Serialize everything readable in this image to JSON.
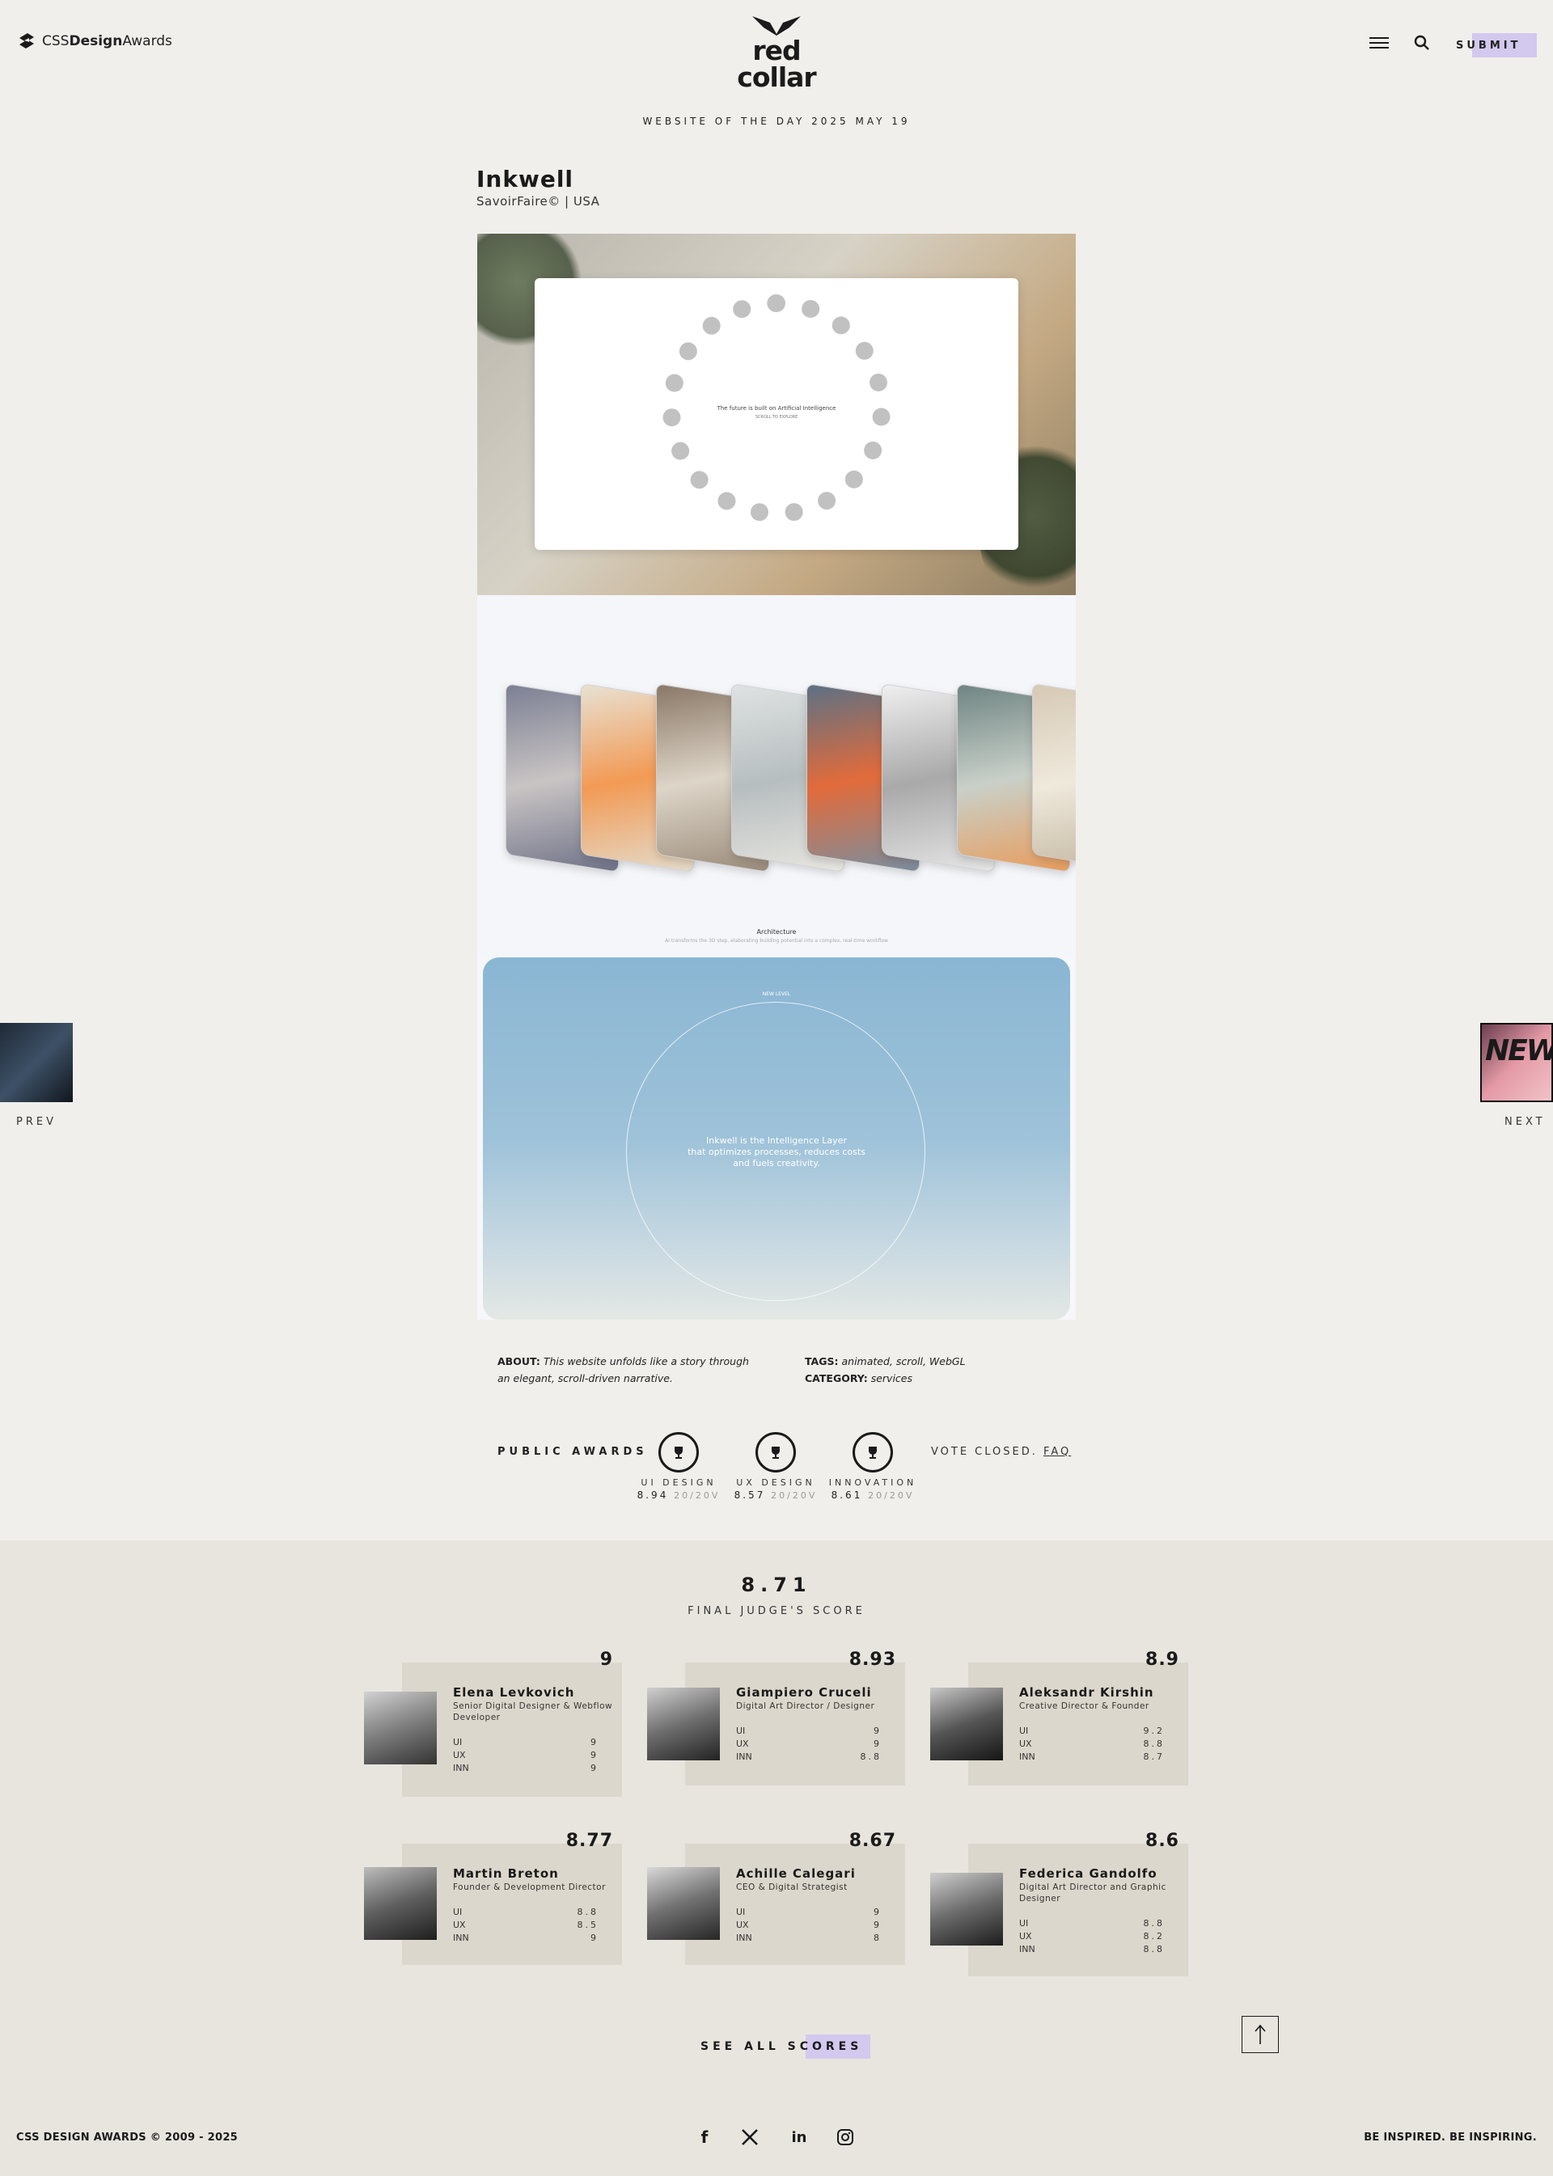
{
  "header": {
    "cssda_logo": {
      "pre": "CSS",
      "bold": "Design",
      "post": "Awards"
    },
    "brand_name": "red collar",
    "submit_label": "SUBMIT"
  },
  "wotd_label": "WEBSITE OF THE DAY 2025 MAY 19",
  "site": {
    "title": "Inkwell",
    "meta": "SavoirFaire©  |  USA"
  },
  "preview": {
    "ring_text": "The future is built on Artificial Intelligence",
    "ring_sub": "SCROLL TO EXPLORE",
    "panel_caption": "Architecture",
    "panel_caption_sub": "AI transforms the 3D step, elaborating building potential into a complex, real-time workflow",
    "blue_small": "NEW LEVEL",
    "blue_text_lines": [
      "Inkwell is the Intelligence Layer",
      "that optimizes processes, reduces costs",
      "and fuels creativity."
    ]
  },
  "nav": {
    "prev_label": "PREV",
    "next_label": "NEXT",
    "next_thumb_text": "NEW"
  },
  "about": {
    "about_label": "ABOUT:",
    "about_text": "This website unfolds like a story through an elegant, scroll-driven narrative.",
    "tags_label": "TAGS:",
    "tags_text": "animated, scroll, WebGL",
    "category_label": "CATEGORY:",
    "category_text": "services"
  },
  "public_awards": {
    "label": "PUBLIC AWARDS",
    "items": [
      {
        "label": "UI DESIGN",
        "score": "8.94",
        "votes": "20/20V"
      },
      {
        "label": "UX DESIGN",
        "score": "8.57",
        "votes": "20/20V"
      },
      {
        "label": "INNOVATION",
        "score": "8.61",
        "votes": "20/20V"
      }
    ],
    "vote_closed": "VOTE CLOSED.",
    "faq": "FAQ"
  },
  "judges": {
    "final_score": "8.71",
    "final_label": "FINAL JUDGE'S SCORE",
    "list": [
      {
        "name": "Elena Levkovich",
        "role": "Senior Digital Designer & Webflow Developer",
        "score": "9",
        "ui": "9",
        "ux": "9",
        "inn": "9"
      },
      {
        "name": "Giampiero Cruceli",
        "role": "Digital Art Director / Designer",
        "score": "8.93",
        "ui": "9",
        "ux": "9",
        "inn": "8.8"
      },
      {
        "name": "Aleksandr Kirshin",
        "role": "Creative Director & Founder",
        "score": "8.9",
        "ui": "9.2",
        "ux": "8.8",
        "inn": "8.7"
      },
      {
        "name": "Martin Breton",
        "role": "Founder & Development Director",
        "score": "8.77",
        "ui": "8.8",
        "ux": "8.5",
        "inn": "9"
      },
      {
        "name": "Achille Calegari",
        "role": "CEO & Digital Strategist",
        "score": "8.67",
        "ui": "9",
        "ux": "9",
        "inn": "8"
      },
      {
        "name": "Federica Gandolfo",
        "role": "Digital Art Director and Graphic Designer",
        "score": "8.6",
        "ui": "8.8",
        "ux": "8.2",
        "inn": "8.8"
      }
    ],
    "row_labels": {
      "ui": "UI",
      "ux": "UX",
      "inn": "INN"
    },
    "see_all": "SEE ALL SCORES"
  },
  "footer": {
    "copyright": "CSS DESIGN AWARDS © 2009 - 2025",
    "tagline": "BE INSPIRED. BE INSPIRING.",
    "social": [
      "facebook-icon",
      "x-icon",
      "linkedin-icon",
      "instagram-icon"
    ]
  },
  "colors": {
    "highlight": "#d3c8ee",
    "judge_card": "#dcd7cc",
    "section_bg": "#e8e5df",
    "page_bg": "#f0efeb"
  }
}
